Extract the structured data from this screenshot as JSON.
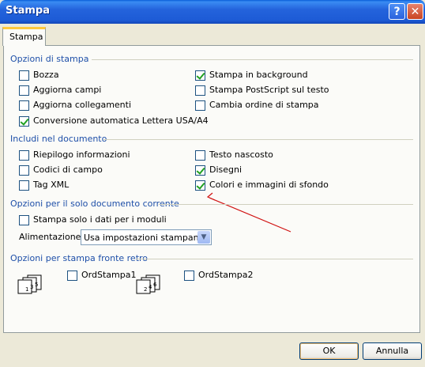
{
  "window": {
    "title": "Stampa"
  },
  "titlebar": {
    "help_glyph": "?",
    "close_glyph": "✕"
  },
  "tab": {
    "label": "Stampa"
  },
  "print_options": {
    "heading": "Opzioni di stampa",
    "left": [
      {
        "label": "Bozza",
        "checked": false
      },
      {
        "label": "Aggiorna campi",
        "checked": false
      },
      {
        "label": "Aggiorna collegamenti",
        "checked": false
      },
      {
        "label": "Conversione automatica Lettera USA/A4",
        "checked": true
      }
    ],
    "right": [
      {
        "label": "Stampa in background",
        "checked": true
      },
      {
        "label": "Stampa PostScript sul testo",
        "checked": false
      },
      {
        "label": "Cambia ordine di stampa",
        "checked": false
      }
    ]
  },
  "include": {
    "heading": "Includi nel documento",
    "left": [
      {
        "label": "Riepilogo informazioni",
        "checked": false
      },
      {
        "label": "Codici di campo",
        "checked": false
      },
      {
        "label": "Tag XML",
        "checked": false
      }
    ],
    "right": [
      {
        "label": "Testo nascosto",
        "checked": false
      },
      {
        "label": "Disegni",
        "checked": true
      },
      {
        "label": "Colori e immagini di sfondo",
        "checked": true
      }
    ]
  },
  "current_doc": {
    "heading": "Opzioni per il solo documento corrente",
    "forms_only": {
      "label": "Stampa solo i dati per i moduli",
      "checked": false
    },
    "feed_label": "Alimentazione:",
    "feed_value": "Usa impostazioni stampante"
  },
  "duplex": {
    "heading": "Opzioni per stampa fronte retro",
    "option1": {
      "label": "OrdStampa1",
      "checked": false
    },
    "option2": {
      "label": "OrdStampa2",
      "checked": false
    },
    "icon1_digits": [
      "1",
      "3",
      "5"
    ],
    "icon2_digits": [
      "2",
      "4",
      "6"
    ]
  },
  "buttons": {
    "ok": "OK",
    "cancel": "Annulla"
  },
  "colors": {
    "heading": "#1e4fa8",
    "check": "#21a121",
    "annotation_arrow": "#d01010"
  }
}
